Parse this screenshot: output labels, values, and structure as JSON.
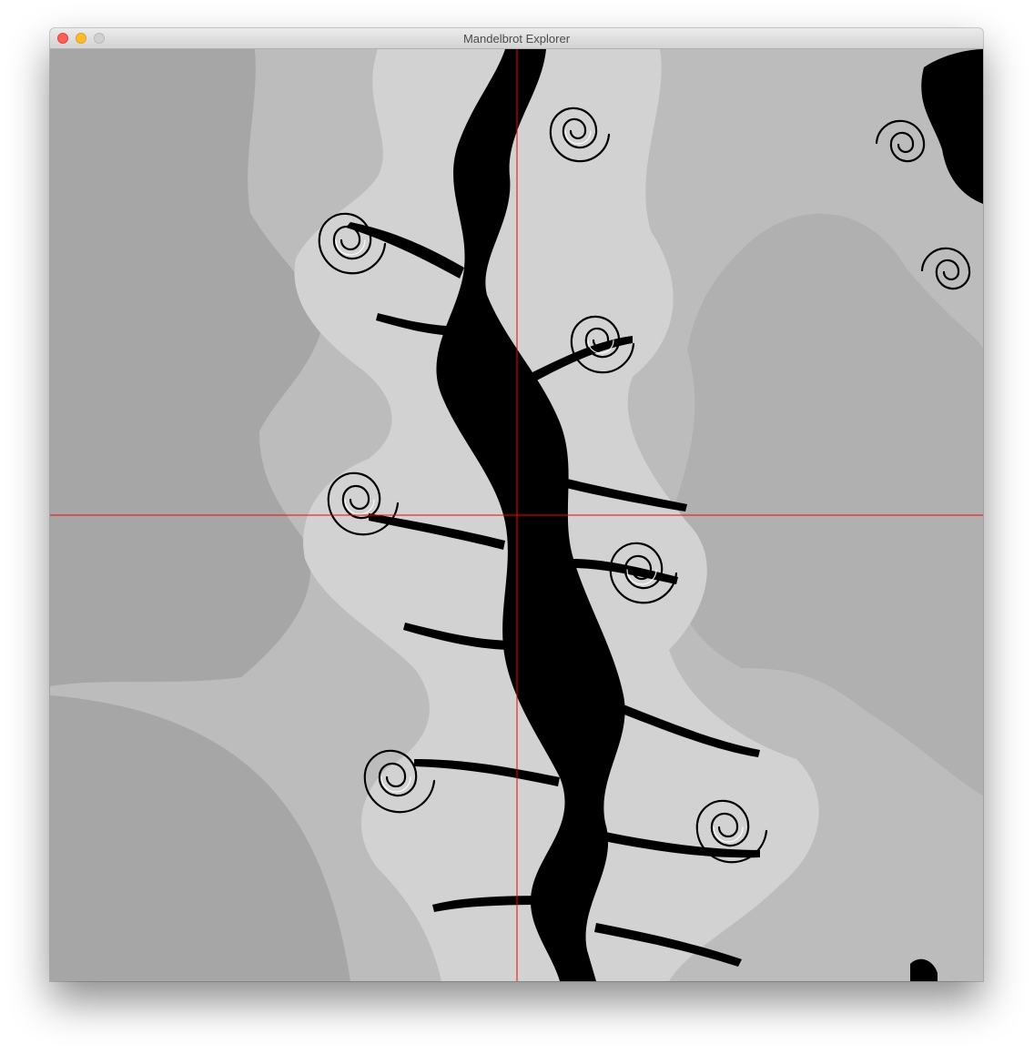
{
  "window": {
    "title": "Mandelbrot Explorer",
    "controls": [
      "close",
      "minimize",
      "zoom"
    ],
    "colors": {
      "close": "#fc5f57",
      "minimize": "#fdbc2e",
      "zoom": "#d0d0d0"
    }
  },
  "viewport": {
    "fractal": "Julia-style filaments with spirals",
    "palette": {
      "outer": "#a6a6a6",
      "band1": "#bcbcbc",
      "band2": "#d2d2d2",
      "set": "#000000",
      "crosshair": "#ff0000"
    },
    "crosshair_icon": "crosshair-icon"
  }
}
